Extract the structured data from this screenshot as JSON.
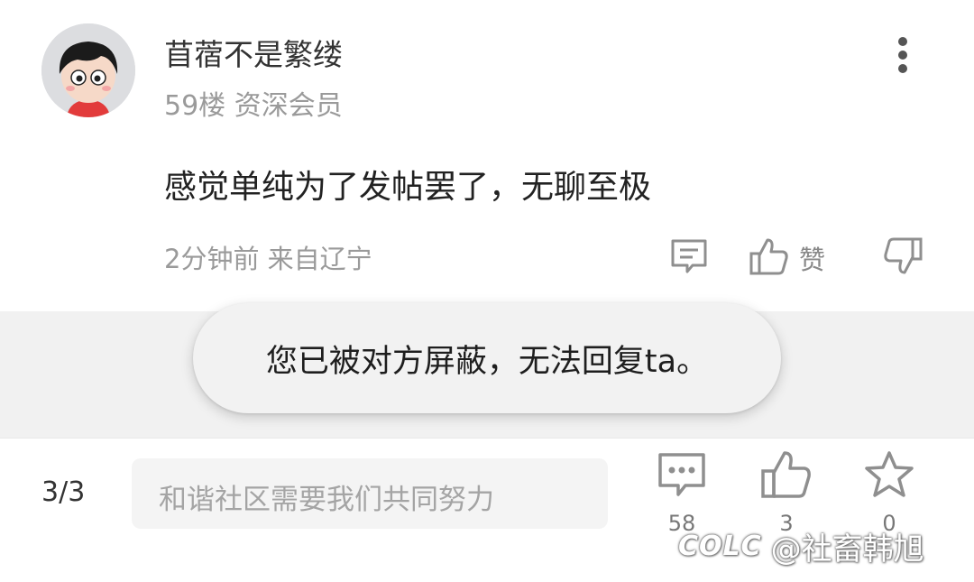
{
  "post": {
    "username": "苜蓿不是繁缕",
    "floor_rank": "59楼 资深会员",
    "content": "感觉单纯为了发帖罢了，无聊至极",
    "time_location": "2分钟前 来自辽宁",
    "like_label": "赞"
  },
  "toast": {
    "message": "您已被对方屏蔽，无法回复ta。"
  },
  "bottom_bar": {
    "page_indicator": "3/3",
    "input_placeholder": "和谐社区需要我们共同努力",
    "comment_count": "58",
    "like_count": "3",
    "favorite_count": "0"
  },
  "watermark": {
    "logo": "COLC",
    "text": "@社畜韩旭"
  },
  "colors": {
    "icon": "#8f8f8f",
    "toast_bg": "#f2f2f2",
    "band_bg": "#f1f1f1"
  }
}
